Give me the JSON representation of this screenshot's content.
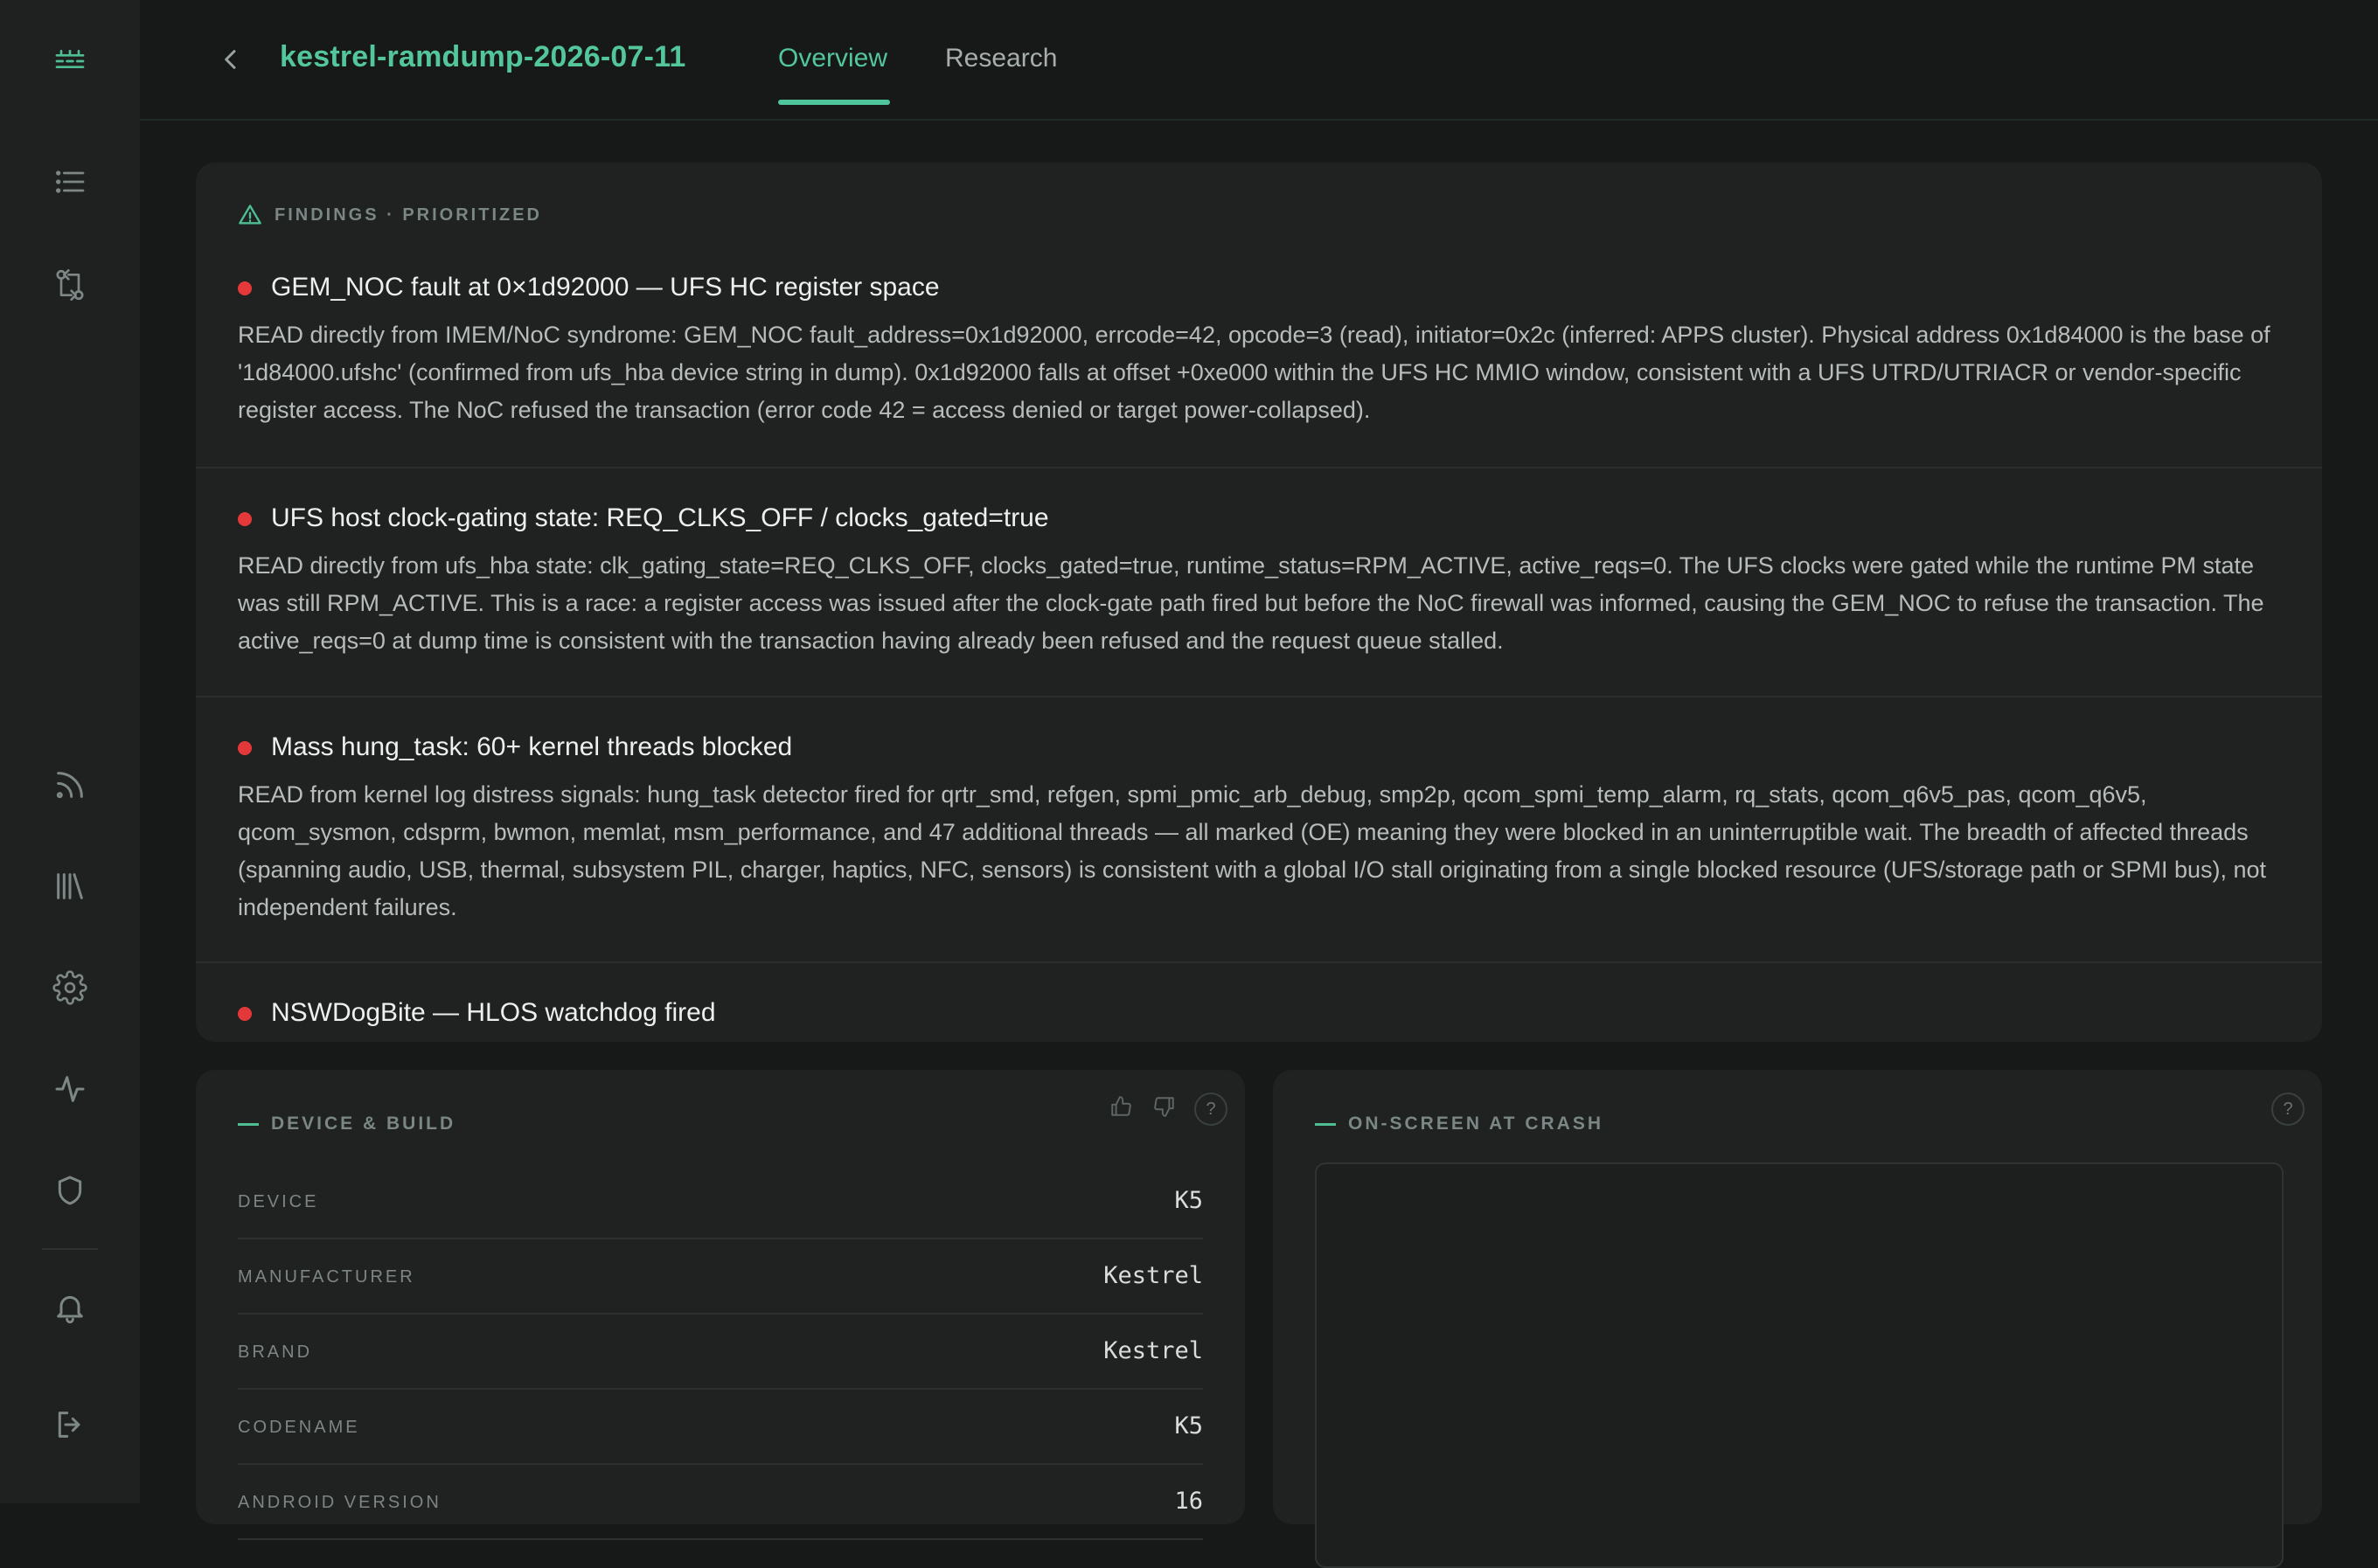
{
  "app": {
    "dump_title": "kestrel-ramdump-2026-07-11",
    "tabs": [
      {
        "label": "Overview",
        "active": true
      },
      {
        "label": "Research",
        "active": false
      }
    ],
    "accent_color": "#4fbf93",
    "severity_color": "#e5383b"
  },
  "sidebar": {
    "icons": [
      "logo-icon",
      "list-icon",
      "compare-icon",
      "feed-icon",
      "library-icon",
      "settings-icon",
      "activity-icon",
      "shield-icon",
      "bell-icon",
      "logout-icon"
    ]
  },
  "findings": {
    "header": "FINDINGS · PRIORITIZED",
    "items": [
      {
        "title": "GEM_NOC fault at 0×1d92000 — UFS HC register space",
        "body": "READ directly from IMEM/NoC syndrome: GEM_NOC fault_address=0x1d92000, errcode=42, opcode=3 (read), initiator=0x2c (inferred: APPS cluster). Physical address 0x1d84000 is the base of '1d84000.ufshc' (confirmed from ufs_hba device string in dump). 0x1d92000 falls at offset +0xe000 within the UFS HC MMIO window, consistent with a UFS UTRD/UTRIACR or vendor-specific register access. The NoC refused the transaction (error code 42 = access denied or target power-collapsed)."
      },
      {
        "title": "UFS host clock-gating state: REQ_CLKS_OFF / clocks_gated=true",
        "body": "READ directly from ufs_hba state: clk_gating_state=REQ_CLKS_OFF, clocks_gated=true, runtime_status=RPM_ACTIVE, active_reqs=0. The UFS clocks were gated while the runtime PM state was still RPM_ACTIVE. This is a race: a register access was issued after the clock-gate path fired but before the NoC firewall was informed, causing the GEM_NOC to refuse the transaction. The active_reqs=0 at dump time is consistent with the transaction having already been refused and the request queue stalled."
      },
      {
        "title": "Mass hung_task: 60+ kernel threads blocked",
        "body": "READ from kernel log distress signals: hung_task detector fired for qrtr_smd, refgen, spmi_pmic_arb_debug, smp2p, qcom_spmi_temp_alarm, rq_stats, qcom_q6v5_pas, qcom_q6v5, qcom_sysmon, cdsprm, bwmon, memlat, msm_performance, and 47 additional threads — all marked (OE) meaning they were blocked in an uninterruptible wait. The breadth of affected threads (spanning audio, USB, thermal, subsystem PIL, charger, haptics, NFC, sensors) is consistent with a global I/O stall originating from a single blocked resource (UFS/storage path or SPMI bus), not independent failures."
      },
      {
        "title": "NSWDogBite — HLOS watchdog fired",
        "body": ""
      }
    ]
  },
  "device_build": {
    "header": "DEVICE & BUILD",
    "rows": [
      {
        "key": "DEVICE",
        "value": "K5"
      },
      {
        "key": "MANUFACTURER",
        "value": "Kestrel"
      },
      {
        "key": "BRAND",
        "value": "Kestrel"
      },
      {
        "key": "CODENAME",
        "value": "K5"
      },
      {
        "key": "ANDROID VERSION",
        "value": "16"
      }
    ]
  },
  "on_screen": {
    "header": "ON-SCREEN AT CRASH",
    "help": "?"
  }
}
